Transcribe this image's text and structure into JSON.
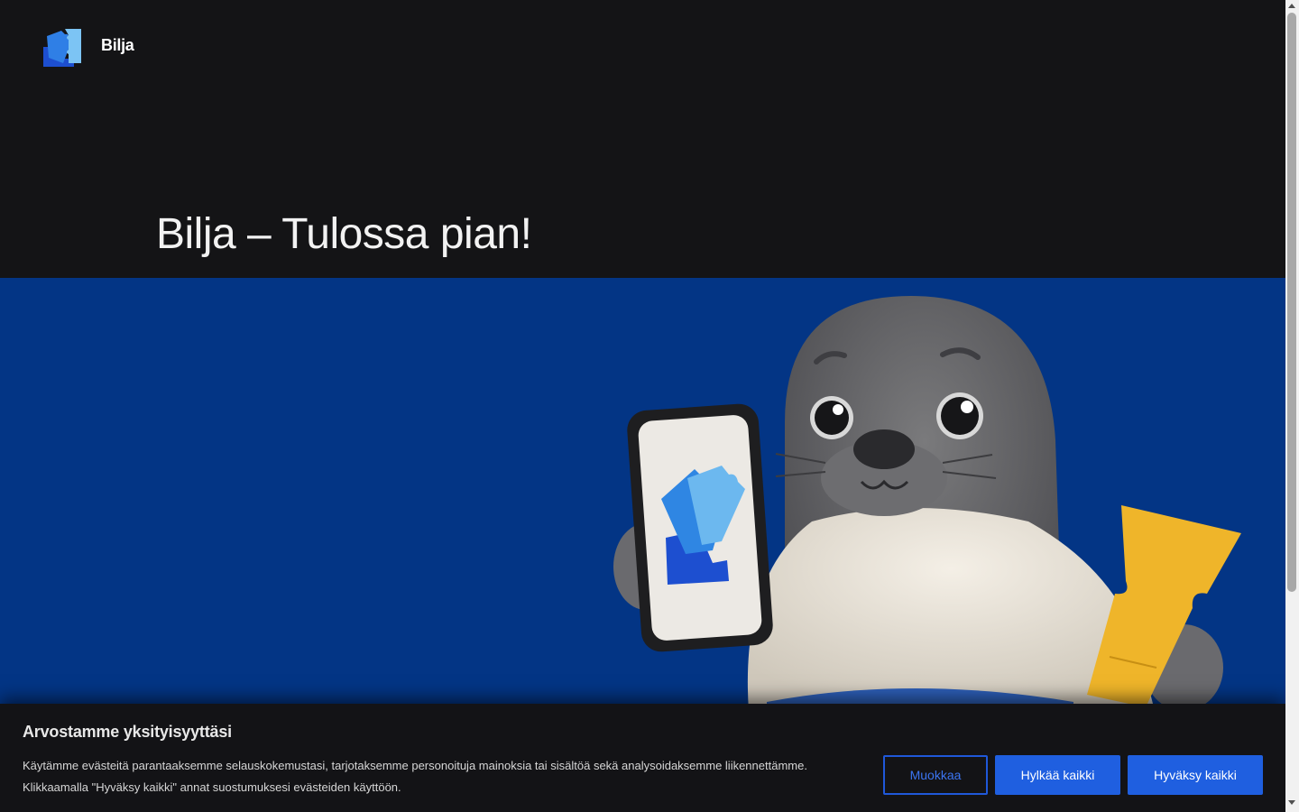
{
  "header": {
    "logo_icon": "ticket-puzzle-logo-icon",
    "brand": "Bilja"
  },
  "hero": {
    "title": "Bilja – Tulossa pian!",
    "background_color": "#033585",
    "illustration": "seal-mascot-with-phone-and-ticket"
  },
  "cookie_banner": {
    "title": "Arvostamme yksityisyyttäsi",
    "text_line1": "Käytämme evästeitä parantaaksemme selauskokemustasi, tarjotaksemme personoituja mainoksia tai sisältöä sekä analysoidaksemme liikennettämme.",
    "text_line2": "Klikkaamalla \"Hyväksy kaikki\" annat suostumuksesi evästeiden käyttöön.",
    "buttons": {
      "customize": "Muokkaa",
      "reject_all": "Hylkää kaikki",
      "accept_all": "Hyväksy kaikki"
    },
    "accent_color": "#1f5fe0"
  }
}
